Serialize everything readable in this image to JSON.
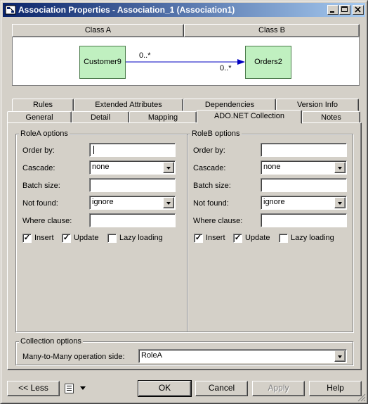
{
  "window": {
    "title": "Association Properties - Association_1 (Association1)",
    "caption_buttons": [
      "minimize",
      "maximize",
      "close"
    ]
  },
  "diagram": {
    "class_a_header": "Class A",
    "class_b_header": "Class B",
    "class_a_name": "Customer9",
    "class_b_name": "Orders2",
    "multiplicity_a": "0..*",
    "multiplicity_b": "0..*"
  },
  "tabs": {
    "row_back": [
      "Rules",
      "Extended Attributes",
      "Dependencies",
      "Version Info"
    ],
    "row_front": [
      "General",
      "Detail",
      "Mapping",
      "ADO.NET Collection",
      "Notes"
    ],
    "active": "ADO.NET Collection"
  },
  "roleA": {
    "group_title": "RoleA options",
    "order_by_label": "Order by:",
    "order_by_value": "",
    "cascade_label": "Cascade:",
    "cascade_value": "none",
    "batch_size_label": "Batch size:",
    "batch_size_value": "",
    "not_found_label": "Not found:",
    "not_found_value": "ignore",
    "where_clause_label": "Where clause:",
    "where_clause_value": "",
    "insert_label": "Insert",
    "update_label": "Update",
    "lazy_label": "Lazy loading",
    "insert_checked": true,
    "update_checked": true,
    "lazy_checked": false
  },
  "roleB": {
    "group_title": "RoleB options",
    "order_by_label": "Order by:",
    "order_by_value": "",
    "cascade_label": "Cascade:",
    "cascade_value": "none",
    "batch_size_label": "Batch size:",
    "batch_size_value": "",
    "not_found_label": "Not found:",
    "not_found_value": "ignore",
    "where_clause_label": "Where clause:",
    "where_clause_value": "",
    "insert_label": "Insert",
    "update_label": "Update",
    "lazy_label": "Lazy loading",
    "insert_checked": true,
    "update_checked": true,
    "lazy_checked": false
  },
  "collection": {
    "group_title": "Collection options",
    "many_to_many_label": "Many-to-Many operation side:",
    "many_to_many_value": "RoleA"
  },
  "buttons": {
    "less": "<< Less",
    "ok": "OK",
    "cancel": "Cancel",
    "apply": "Apply",
    "help": "Help"
  },
  "colors": {
    "titlebar_start": "#0a246a",
    "titlebar_end": "#a6caf0",
    "class_fill": "#c0f0c0",
    "link_color": "#0000c0"
  }
}
